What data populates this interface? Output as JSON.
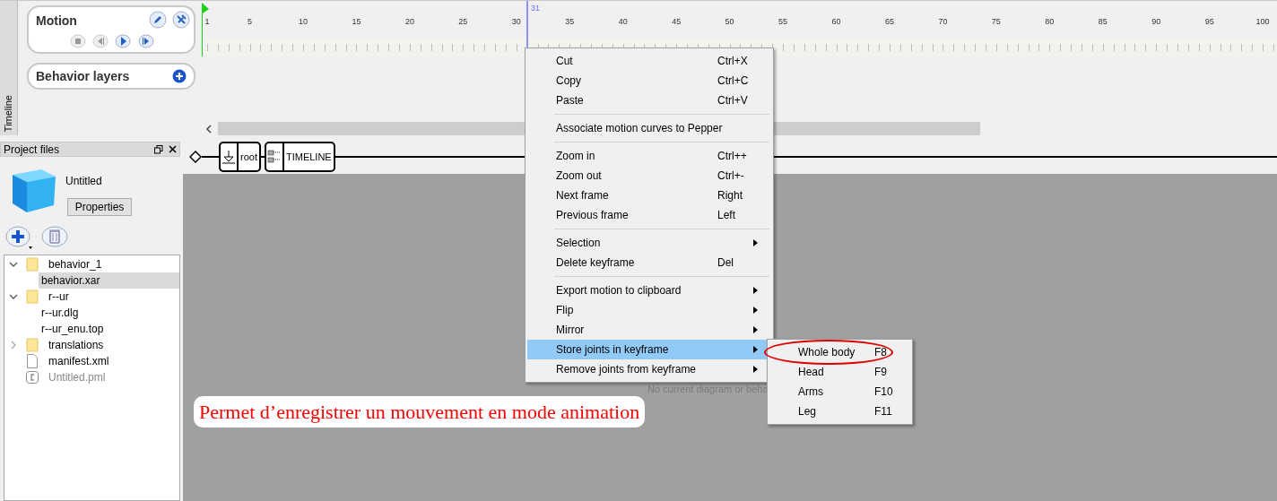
{
  "timeline_tab": {
    "label": "Timeline"
  },
  "motion_panel": {
    "title": "Motion"
  },
  "behavior_layers": {
    "title": "Behavior layers"
  },
  "ruler": {
    "labels": [
      "1",
      "5",
      "10",
      "15",
      "20",
      "25",
      "30",
      "35",
      "40",
      "45",
      "50",
      "55",
      "60",
      "65",
      "70",
      "75",
      "80",
      "85",
      "90",
      "95",
      "100"
    ],
    "playhead": "31"
  },
  "project_files": {
    "title": "Project files",
    "project_name": "Untitled",
    "properties_button": "Properties",
    "tree": [
      {
        "label": "behavior_1",
        "kind": "folder",
        "expanded": true,
        "selected": false,
        "children": [
          {
            "label": "behavior.xar",
            "selected": true
          }
        ]
      },
      {
        "label": "r--ur",
        "kind": "folder",
        "expanded": true,
        "selected": false,
        "children": [
          {
            "label": "r--ur.dlg",
            "selected": false
          },
          {
            "label": "r--ur_enu.top",
            "selected": false
          }
        ]
      },
      {
        "label": "translations",
        "kind": "folder",
        "expanded": false,
        "selected": false
      },
      {
        "label": "manifest.xml",
        "kind": "file",
        "selected": false
      },
      {
        "label": "Untitled.pml",
        "kind": "pml",
        "selected": false
      }
    ]
  },
  "breadcrumb": [
    {
      "label": "root",
      "kind": "root"
    },
    {
      "label": "TIMELINE",
      "kind": "timeline"
    }
  ],
  "diagram": {
    "empty_message": "No current diagram or beha"
  },
  "context_menu": {
    "groups": [
      [
        {
          "label": "Cut",
          "shortcut": "Ctrl+X",
          "submenu": false,
          "selected": false
        },
        {
          "label": "Copy",
          "shortcut": "Ctrl+C",
          "submenu": false,
          "selected": false
        },
        {
          "label": "Paste",
          "shortcut": "Ctrl+V",
          "submenu": false,
          "selected": false
        }
      ],
      [
        {
          "label": "Associate motion curves to Pepper",
          "submenu": false,
          "selected": false
        }
      ],
      [
        {
          "label": "Zoom in",
          "shortcut": "Ctrl++",
          "submenu": false,
          "selected": false
        },
        {
          "label": "Zoom out",
          "shortcut": "Ctrl+-",
          "submenu": false,
          "selected": false
        },
        {
          "label": "Next frame",
          "shortcut": "Right",
          "submenu": false,
          "selected": false
        },
        {
          "label": "Previous frame",
          "shortcut": "Left",
          "submenu": false,
          "selected": false
        }
      ],
      [
        {
          "label": "Selection",
          "submenu": true,
          "selected": false
        },
        {
          "label": "Delete keyframe",
          "shortcut": "Del",
          "submenu": false,
          "selected": false
        }
      ],
      [
        {
          "label": "Export motion to clipboard",
          "submenu": true,
          "selected": false
        },
        {
          "label": "Flip",
          "submenu": true,
          "selected": false
        },
        {
          "label": "Mirror",
          "submenu": true,
          "selected": false
        },
        {
          "label": "Store joints in keyframe",
          "submenu": true,
          "selected": true
        },
        {
          "label": "Remove joints from keyframe",
          "submenu": true,
          "selected": false
        }
      ]
    ]
  },
  "submenu": [
    {
      "label": "Whole body",
      "shortcut": "F8",
      "circled": true
    },
    {
      "label": "Head",
      "shortcut": "F9",
      "circled": false
    },
    {
      "label": "Arms",
      "shortcut": "F10",
      "circled": false
    },
    {
      "label": "Leg",
      "shortcut": "F11",
      "circled": false
    }
  ],
  "caption": "Permet d’enregistrer un mouvement en mode animation"
}
